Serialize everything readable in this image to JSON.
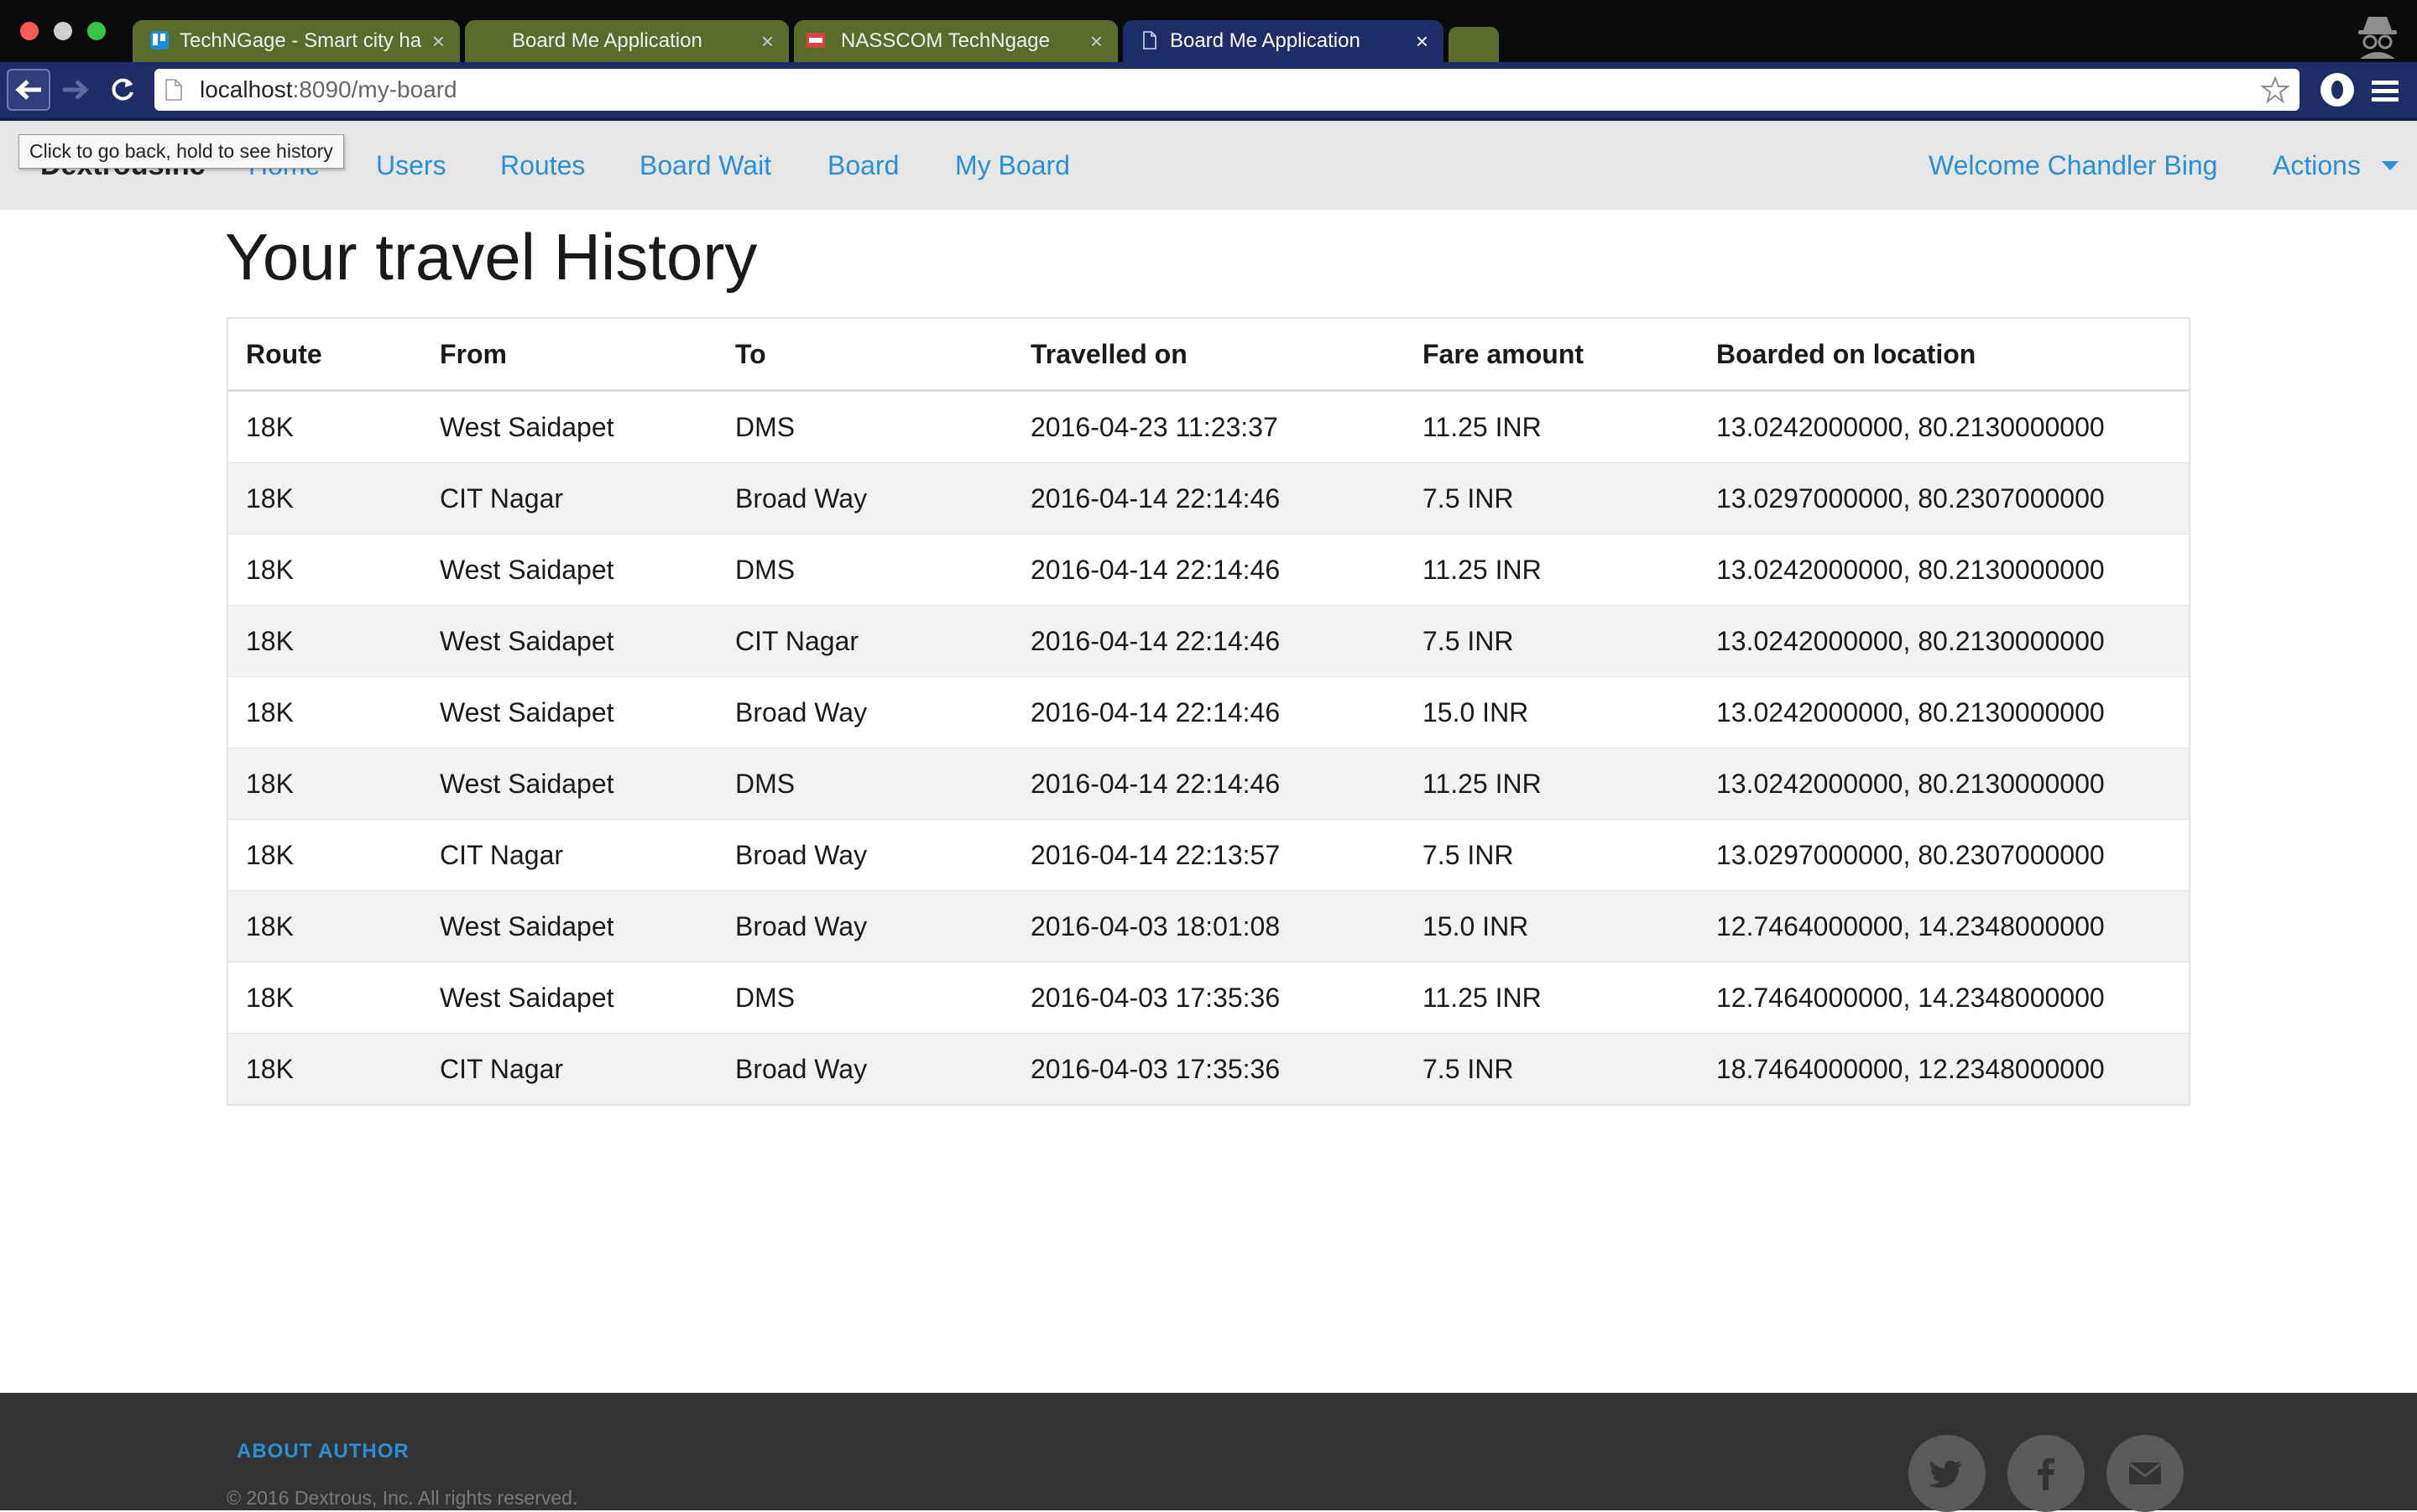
{
  "browser": {
    "tabs": [
      {
        "title": "TechNGage - Smart city ha",
        "icon": "trello-icon"
      },
      {
        "title": "Board Me Application",
        "icon": "blank-icon"
      },
      {
        "title": "NASSCOM TechNgage",
        "icon": "nasscom-icon"
      },
      {
        "title": "Board Me Application",
        "icon": "page-icon",
        "active": true
      }
    ],
    "url_host": "localhost",
    "url_path": ":8090/my-board",
    "back_tooltip": "Click to go back, hold to see history"
  },
  "navbar": {
    "brand": "Dextrousinc",
    "links": [
      "Home",
      "Users",
      "Routes",
      "Board Wait",
      "Board",
      "My Board"
    ],
    "welcome": "Welcome Chandler Bing",
    "actions": "Actions"
  },
  "main": {
    "title": "Your travel History",
    "columns": [
      "Route",
      "From",
      "To",
      "Travelled on",
      "Fare amount",
      "Boarded on location"
    ],
    "rows": [
      [
        "18K",
        "West Saidapet",
        "DMS",
        "2016-04-23 11:23:37",
        "11.25 INR",
        "13.0242000000, 80.2130000000"
      ],
      [
        "18K",
        "CIT Nagar",
        "Broad Way",
        "2016-04-14 22:14:46",
        "7.5 INR",
        "13.0297000000, 80.2307000000"
      ],
      [
        "18K",
        "West Saidapet",
        "DMS",
        "2016-04-14 22:14:46",
        "11.25 INR",
        "13.0242000000, 80.2130000000"
      ],
      [
        "18K",
        "West Saidapet",
        "CIT Nagar",
        "2016-04-14 22:14:46",
        "7.5 INR",
        "13.0242000000, 80.2130000000"
      ],
      [
        "18K",
        "West Saidapet",
        "Broad Way",
        "2016-04-14 22:14:46",
        "15.0 INR",
        "13.0242000000, 80.2130000000"
      ],
      [
        "18K",
        "West Saidapet",
        "DMS",
        "2016-04-14 22:14:46",
        "11.25 INR",
        "13.0242000000, 80.2130000000"
      ],
      [
        "18K",
        "CIT Nagar",
        "Broad Way",
        "2016-04-14 22:13:57",
        "7.5 INR",
        "13.0297000000, 80.2307000000"
      ],
      [
        "18K",
        "West Saidapet",
        "Broad Way",
        "2016-04-03 18:01:08",
        "15.0 INR",
        "12.7464000000, 14.2348000000"
      ],
      [
        "18K",
        "West Saidapet",
        "DMS",
        "2016-04-03 17:35:36",
        "11.25 INR",
        "12.7464000000, 14.2348000000"
      ],
      [
        "18K",
        "CIT Nagar",
        "Broad Way",
        "2016-04-03 17:35:36",
        "7.5 INR",
        "18.7464000000, 12.2348000000"
      ]
    ]
  },
  "footer": {
    "about": "ABOUT AUTHOR",
    "copyright": "© 2016 Dextrous, Inc. All rights reserved.",
    "social": [
      "twitter-icon",
      "facebook-icon",
      "mail-icon"
    ]
  },
  "colors": {
    "link": "#2a8fd4",
    "chrome_toolbar": "#1e2d66",
    "footer_bg": "#333333"
  }
}
